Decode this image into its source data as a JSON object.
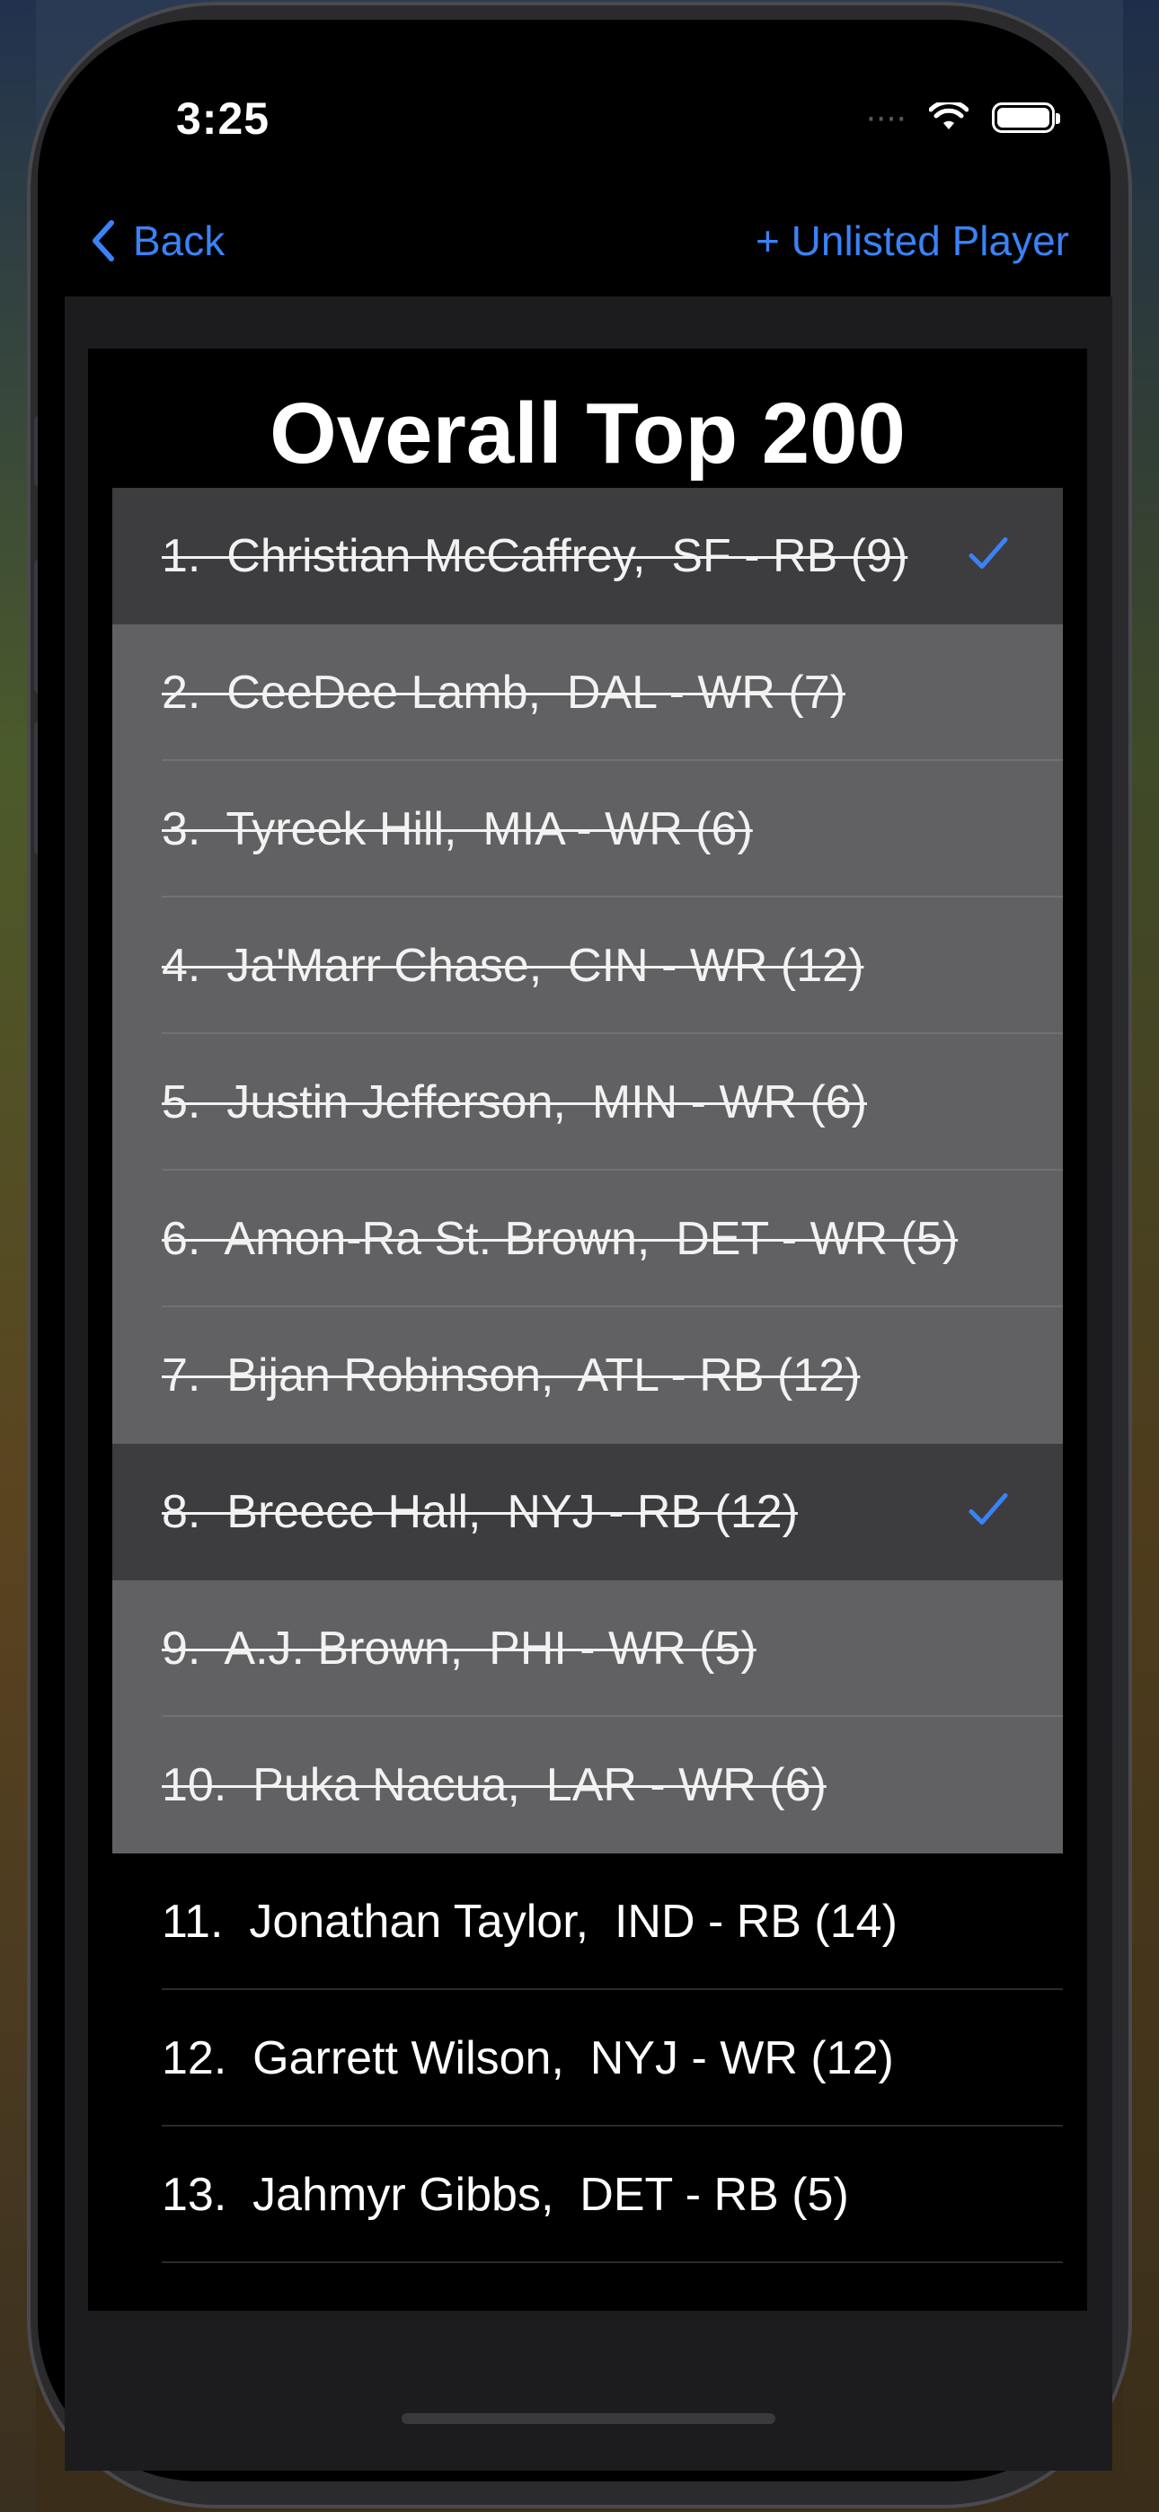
{
  "status": {
    "time": "3:25",
    "signal": "····"
  },
  "nav": {
    "back_label": "Back",
    "add_label": "+ Unlisted Player"
  },
  "list": {
    "title": "Overall Top 200",
    "players": [
      {
        "text": "1.  Christian McCaffrey,  SF - RB (9)",
        "state": "mine"
      },
      {
        "text": "2.  CeeDee Lamb,  DAL - WR (7)",
        "state": "drafted"
      },
      {
        "text": "3.  Tyreek Hill,  MIA - WR (6)",
        "state": "drafted"
      },
      {
        "text": "4.  Ja'Marr Chase,  CIN - WR (12)",
        "state": "drafted"
      },
      {
        "text": "5.  Justin Jefferson,  MIN - WR (6)",
        "state": "drafted"
      },
      {
        "text": "6.  Amon-Ra St. Brown,  DET - WR (5)",
        "state": "drafted"
      },
      {
        "text": "7.  Bijan Robinson,  ATL - RB (12)",
        "state": "drafted"
      },
      {
        "text": "8.  Breece Hall,  NYJ - RB (12)",
        "state": "mine"
      },
      {
        "text": "9.  A.J. Brown,  PHI - WR (5)",
        "state": "drafted"
      },
      {
        "text": "10.  Puka Nacua,  LAR - WR (6)",
        "state": "drafted"
      },
      {
        "text": "11.  Jonathan Taylor,  IND - RB (14)",
        "state": "available"
      },
      {
        "text": "12.  Garrett Wilson,  NYJ - WR (12)",
        "state": "available"
      },
      {
        "text": "13.  Jahmyr Gibbs,  DET - RB (5)",
        "state": "available"
      }
    ]
  },
  "colors": {
    "accent": "#3a82f6",
    "drafted_row": "#616163",
    "my_pick_row": "#3d3d40"
  },
  "icons": {
    "back": "chevron-left-icon",
    "check": "checkmark-icon",
    "wifi": "wifi-icon",
    "battery": "battery-icon"
  }
}
